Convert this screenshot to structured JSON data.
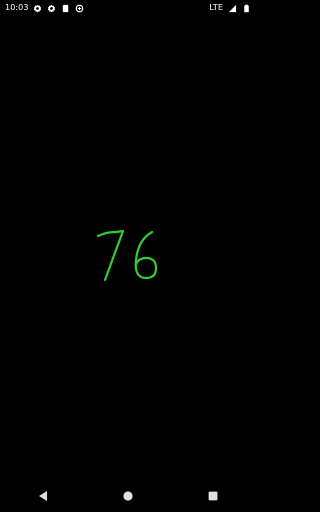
{
  "status_bar": {
    "time": "10:03",
    "network": "LTE",
    "icons_left": [
      "gear-icon",
      "gear-icon",
      "sim-card-icon",
      "data-saver-icon"
    ],
    "icons_right": [
      "signal-icon",
      "battery-icon"
    ]
  },
  "main": {
    "value": "76",
    "value_color": "#33cc33"
  },
  "nav_bar": {
    "buttons": [
      "back-icon",
      "home-icon",
      "recents-icon"
    ]
  }
}
